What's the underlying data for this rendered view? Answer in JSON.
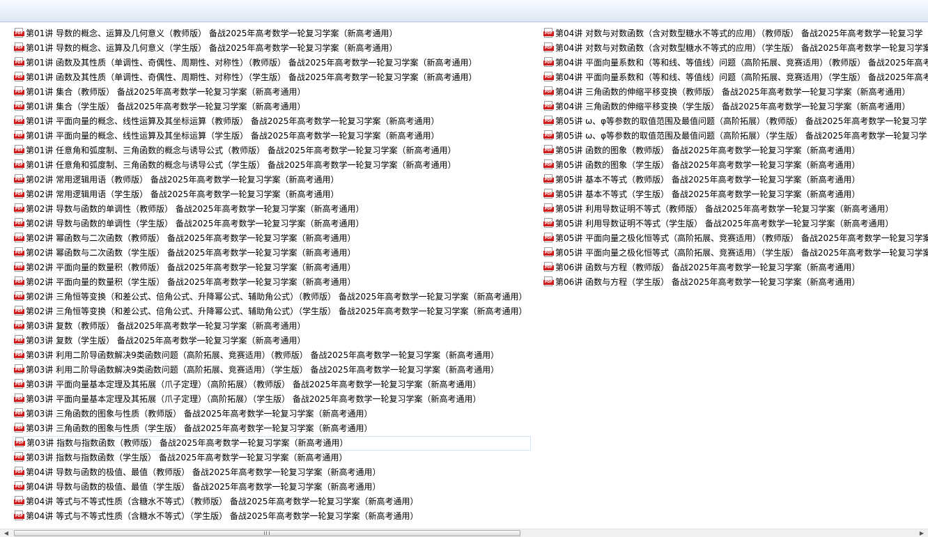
{
  "icon_label": "PDF",
  "icons": {
    "file": "pdf-file-icon",
    "scroll_left": "chevron-left-icon",
    "scroll_right": "chevron-right-icon"
  },
  "colors": {
    "pdf_red": "#cf1b1b",
    "header": "#eaf1fb",
    "selection_border": "#d5e3f3"
  },
  "selected_index": 28,
  "columns": [
    [
      "第01讲 导数的概念、运算及几何意义（教师版） 备战2025年高考数学一轮复习学案（新高考通用）",
      "第01讲 导数的概念、运算及几何意义（学生版） 备战2025年高考数学一轮复习学案（新高考通用）",
      "第01讲 函数及其性质（单调性、奇偶性、周期性、对称性）（教师版） 备战2025年高考数学一轮复习学案（新高考通用）",
      "第01讲 函数及其性质（单调性、奇偶性、周期性、对称性）（学生版） 备战2025年高考数学一轮复习学案（新高考通用）",
      "第01讲 集合（教师版） 备战2025年高考数学一轮复习学案（新高考通用）",
      "第01讲 集合（学生版） 备战2025年高考数学一轮复习学案（新高考通用）",
      "第01讲 平面向量的概念、线性运算及其坐标运算（教师版） 备战2025年高考数学一轮复习学案（新高考通用）",
      "第01讲 平面向量的概念、线性运算及其坐标运算（学生版） 备战2025年高考数学一轮复习学案（新高考通用）",
      "第01讲 任意角和弧度制、三角函数的概念与诱导公式（教师版） 备战2025年高考数学一轮复习学案（新高考通用）",
      "第01讲 任意角和弧度制、三角函数的概念与诱导公式（学生版） 备战2025年高考数学一轮复习学案（新高考通用）",
      "第02讲 常用逻辑用语（教师版） 备战2025年高考数学一轮复习学案（新高考通用）",
      "第02讲 常用逻辑用语（学生版） 备战2025年高考数学一轮复习学案（新高考通用）",
      "第02讲 导数与函数的单调性（教师版） 备战2025年高考数学一轮复习学案（新高考通用）",
      "第02讲 导数与函数的单调性（学生版） 备战2025年高考数学一轮复习学案（新高考通用）",
      "第02讲 幂函数与二次函数（教师版） 备战2025年高考数学一轮复习学案（新高考通用）",
      "第02讲 幂函数与二次函数（学生版） 备战2025年高考数学一轮复习学案（新高考通用）",
      "第02讲 平面向量的数量积（教师版） 备战2025年高考数学一轮复习学案（新高考通用）",
      "第02讲 平面向量的数量积（学生版） 备战2025年高考数学一轮复习学案（新高考通用）",
      "第02讲 三角恒等变换（和差公式、倍角公式、升降幂公式、辅助角公式）（教师版） 备战2025年高考数学一轮复习学案（新高考通用）",
      "第02讲 三角恒等变换（和差公式、倍角公式、升降幂公式、辅助角公式）（学生版） 备战2025年高考数学一轮复习学案（新高考通用）",
      "第03讲 复数（教师版） 备战2025年高考数学一轮复习学案（新高考通用）",
      "第03讲 复数（学生版） 备战2025年高考数学一轮复习学案（新高考通用）",
      "第03讲 利用二阶导函数解决9类函数问题（高阶拓展、竞赛适用）（教师版） 备战2025年高考数学一轮复习学案（新高考通用）",
      "第03讲 利用二阶导函数解决9类函数问题（高阶拓展、竞赛适用）（学生版） 备战2025年高考数学一轮复习学案（新高考通用）",
      "第03讲 平面向量基本定理及其拓展（爪子定理）（高阶拓展）（教师版） 备战2025年高考数学一轮复习学案（新高考通用）",
      "第03讲 平面向量基本定理及其拓展（爪子定理）（高阶拓展）（学生版） 备战2025年高考数学一轮复习学案（新高考通用）",
      "第03讲 三角函数的图象与性质（教师版） 备战2025年高考数学一轮复习学案（新高考通用）",
      "第03讲 三角函数的图象与性质（学生版） 备战2025年高考数学一轮复习学案（新高考通用）",
      "第03讲 指数与指数函数（教师版） 备战2025年高考数学一轮复习学案（新高考通用）",
      "第03讲 指数与指数函数（学生版） 备战2025年高考数学一轮复习学案（新高考通用）",
      "第04讲 导数与函数的极值、最值（教师版） 备战2025年高考数学一轮复习学案（新高考通用）",
      "第04讲 导数与函数的极值、最值（学生版） 备战2025年高考数学一轮复习学案（新高考通用）",
      "第04讲 等式与不等式性质（含糖水不等式）（教师版） 备战2025年高考数学一轮复习学案（新高考通用）",
      "第04讲 等式与不等式性质（含糖水不等式）（学生版） 备战2025年高考数学一轮复习学案（新高考通用）"
    ],
    [
      "第04讲 对数与对数函数（含对数型糖水不等式的应用）（教师版） 备战2025年高考数学一轮复习学",
      "第04讲 对数与对数函数（含对数型糖水不等式的应用）（学生版） 备战2025年高考数学一轮复习学案",
      "第04讲 平面向量系数和（等和线、等值线）问题（高阶拓展、竞赛适用）（教师版） 备战2025年高考",
      "第04讲 平面向量系数和（等和线、等值线）问题（高阶拓展、竞赛适用）（学生版） 备战2025年高考",
      "第04讲 三角函数的伸缩平移变换（教师版） 备战2025年高考数学一轮复习学案（新高考通用）",
      "第04讲 三角函数的伸缩平移变换（学生版） 备战2025年高考数学一轮复习学案（新高考通用）",
      "第05讲 ω、φ等参数的取值范围及最值问题（高阶拓展）（教师版） 备战2025年高考数学一轮复习学",
      "第05讲 ω、φ等参数的取值范围及最值问题（高阶拓展）（学生版） 备战2025年高考数学一轮复习学",
      "第05讲 函数的图象（教师版） 备战2025年高考数学一轮复习学案（新高考通用）",
      "第05讲 函数的图象（学生版） 备战2025年高考数学一轮复习学案（新高考通用）",
      "第05讲 基本不等式（教师版） 备战2025年高考数学一轮复习学案（新高考通用）",
      "第05讲 基本不等式（学生版） 备战2025年高考数学一轮复习学案（新高考通用）",
      "第05讲 利用导数证明不等式（教师版） 备战2025年高考数学一轮复习学案（新高考通用）",
      "第05讲 利用导数证明不等式（学生版） 备战2025年高考数学一轮复习学案（新高考通用）",
      "第05讲 平面向量之极化恒等式（高阶拓展、竞赛适用）（教师版） 备战2025年高考数学一轮复习学案",
      "第05讲 平面向量之极化恒等式（高阶拓展、竞赛适用）（学生版） 备战2025年高考数学一轮复习学案",
      "第06讲 函数与方程（教师版） 备战2025年高考数学一轮复习学案（新高考通用）",
      "第06讲 函数与方程（学生版） 备战2025年高考数学一轮复习学案（新高考通用）"
    ]
  ]
}
